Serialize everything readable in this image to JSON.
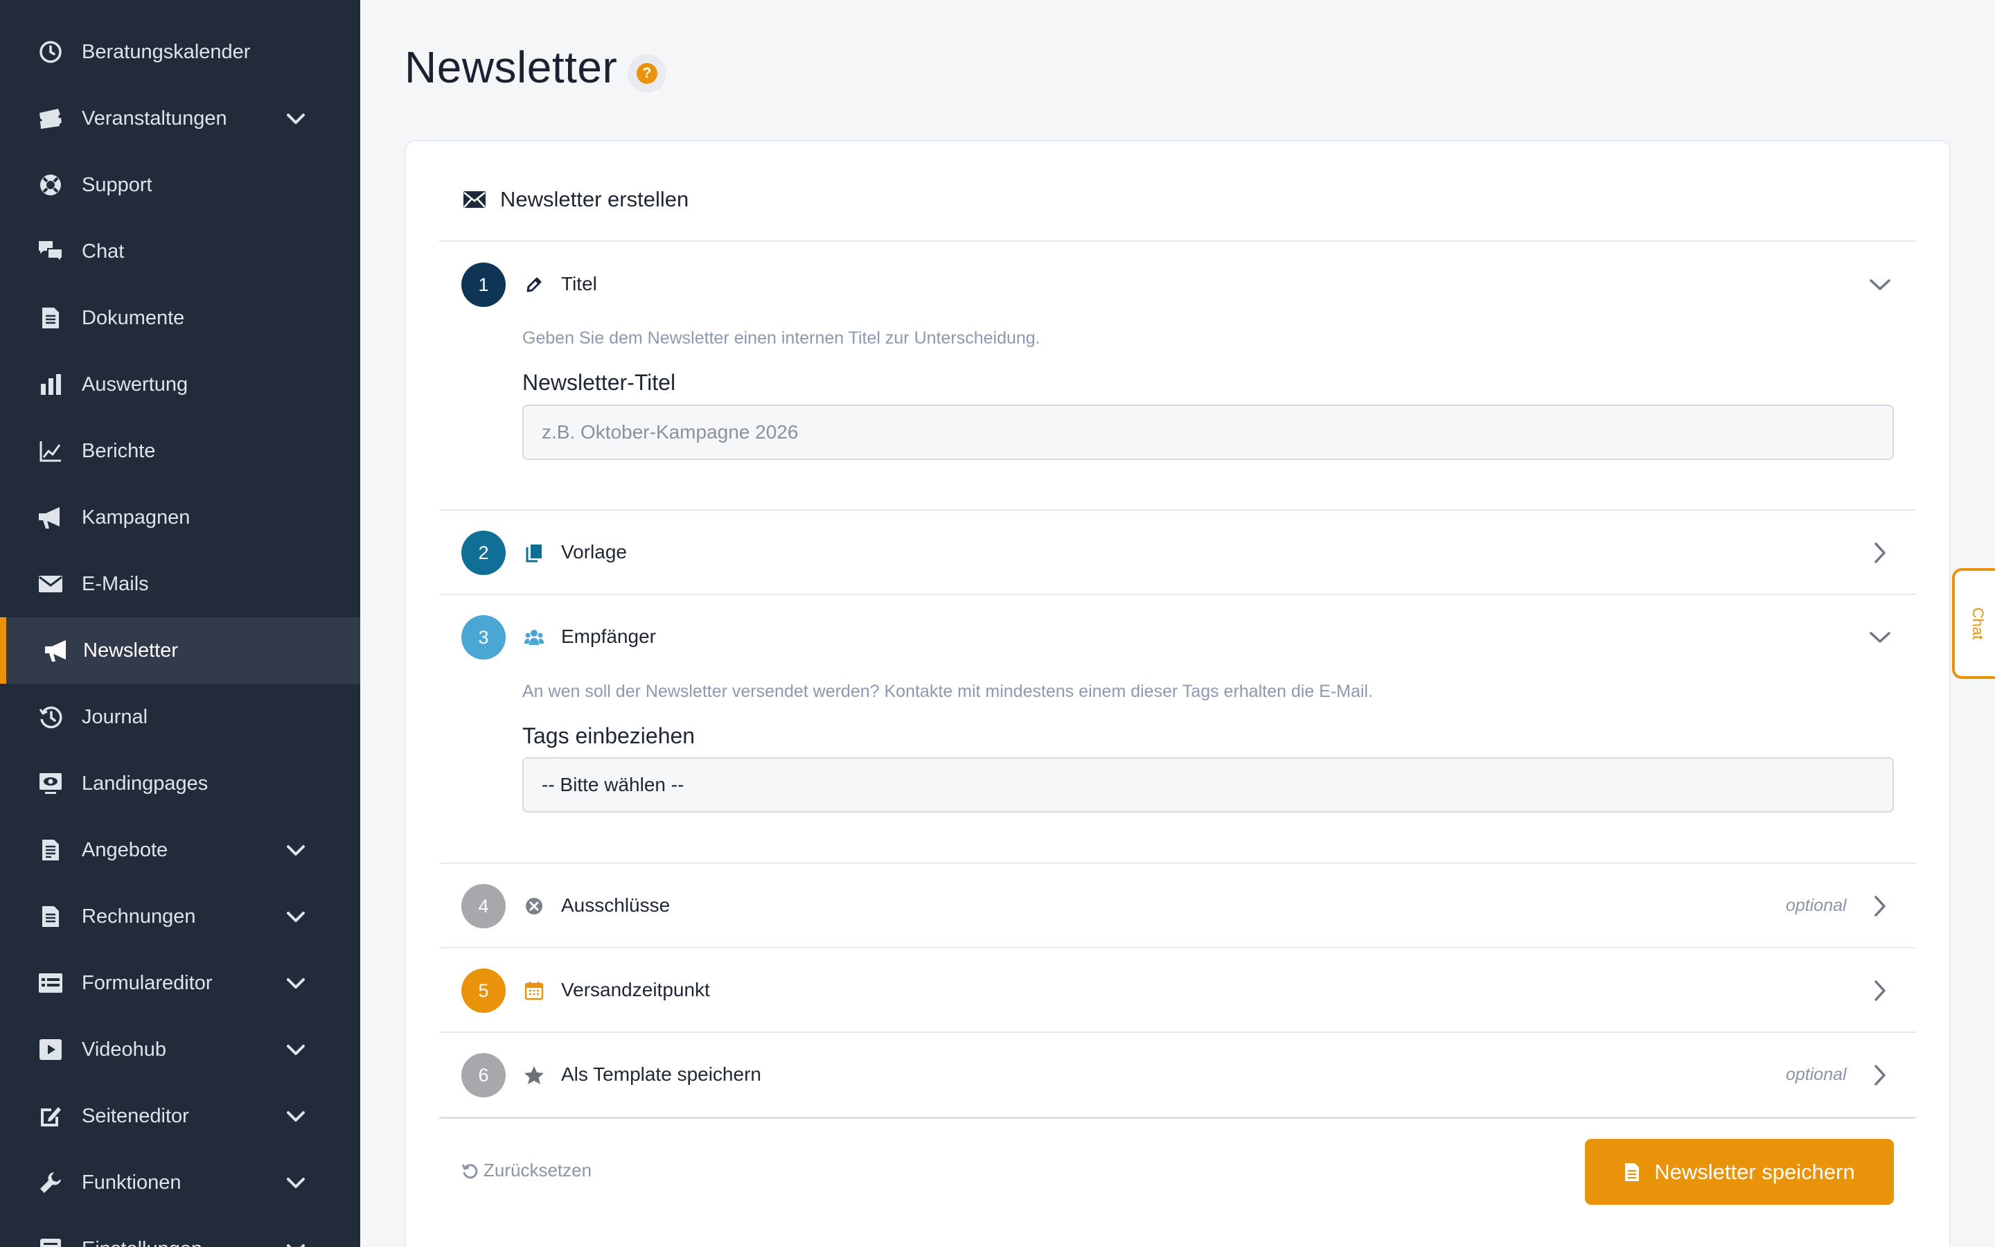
{
  "colors": {
    "sidebar_bg": "#222b3a",
    "accent": "#e9930a",
    "step1": "#0e3554",
    "step2": "#0f6f96",
    "step3": "#4aa7d3",
    "step4": "#a7a8ab",
    "step5": "#e9930a",
    "step6": "#a7a8ab"
  },
  "sidebar": {
    "items": [
      {
        "label": "Beratungskalender",
        "icon": "clock-icon",
        "expandable": false
      },
      {
        "label": "Veranstaltungen",
        "icon": "tickets-icon",
        "expandable": true
      },
      {
        "label": "Support",
        "icon": "lifebuoy-icon",
        "expandable": false
      },
      {
        "label": "Chat",
        "icon": "chat-bubbles-icon",
        "expandable": false
      },
      {
        "label": "Dokumente",
        "icon": "document-icon",
        "expandable": false
      },
      {
        "label": "Auswertung",
        "icon": "bar-chart-icon",
        "expandable": false
      },
      {
        "label": "Berichte",
        "icon": "line-chart-icon",
        "expandable": false
      },
      {
        "label": "Kampagnen",
        "icon": "megaphone-icon",
        "expandable": false
      },
      {
        "label": "E-Mails",
        "icon": "envelope-icon",
        "expandable": false
      },
      {
        "label": "Newsletter",
        "icon": "megaphone-icon",
        "expandable": false,
        "active": true
      },
      {
        "label": "Journal",
        "icon": "history-icon",
        "expandable": false
      },
      {
        "label": "Landingpages",
        "icon": "screen-eye-icon",
        "expandable": false
      },
      {
        "label": "Angebote",
        "icon": "invoice-icon",
        "expandable": true
      },
      {
        "label": "Rechnungen",
        "icon": "receipt-icon",
        "expandable": true
      },
      {
        "label": "Formulareditor",
        "icon": "form-icon",
        "expandable": true
      },
      {
        "label": "Videohub",
        "icon": "video-play-icon",
        "expandable": true
      },
      {
        "label": "Seiteneditor",
        "icon": "edit-page-icon",
        "expandable": true
      },
      {
        "label": "Funktionen",
        "icon": "wrench-icon",
        "expandable": true
      },
      {
        "label": "Einstellungen",
        "icon": "settings-icon",
        "expandable": true
      }
    ]
  },
  "page": {
    "title": "Newsletter",
    "help_symbol": "?"
  },
  "card": {
    "header": "Newsletter erstellen"
  },
  "steps": [
    {
      "number": "1",
      "title": "Titel",
      "icon": "pencil-icon",
      "expanded": true,
      "description": "Geben Sie dem Newsletter einen internen Titel zur Unterscheidung.",
      "field_label": "Newsletter-Titel",
      "placeholder": "z.B. Oktober-Kampagne 2026",
      "value": ""
    },
    {
      "number": "2",
      "title": "Vorlage",
      "icon": "copy-icon",
      "expanded": false
    },
    {
      "number": "3",
      "title": "Empfänger",
      "icon": "users-icon",
      "expanded": true,
      "description": "An wen soll der Newsletter versendet werden? Kontakte mit mindestens einem dieser Tags erhalten die E-Mail.",
      "field_label": "Tags einbeziehen",
      "select_value": "-- Bitte wählen --"
    },
    {
      "number": "4",
      "title": "Ausschlüsse",
      "icon": "x-circle-icon",
      "expanded": false,
      "optional": "optional"
    },
    {
      "number": "5",
      "title": "Versandzeitpunkt",
      "icon": "calendar-icon",
      "expanded": false
    },
    {
      "number": "6",
      "title": "Als Template speichern",
      "icon": "star-icon",
      "expanded": false,
      "optional": "optional"
    }
  ],
  "footer": {
    "reset_label": "Zurücksetzen",
    "save_label": "Newsletter speichern"
  },
  "chat_tab": {
    "label": "Chat"
  }
}
